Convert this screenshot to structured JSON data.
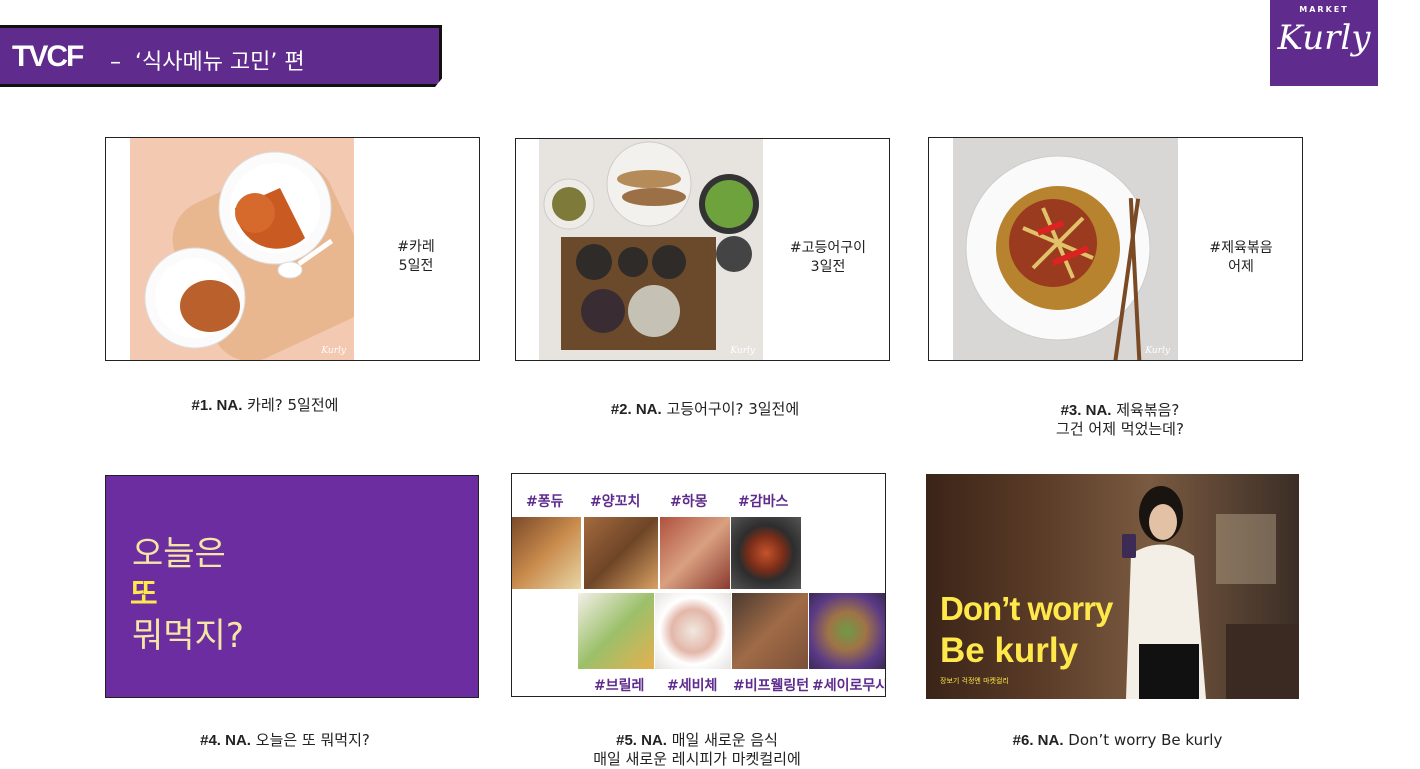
{
  "header": {
    "title": "TVCF",
    "subtitle": "–  ‘식사메뉴 고민’ 편"
  },
  "logo": {
    "top": "MARKET",
    "name": "Kurly"
  },
  "watermark": "Kurly",
  "scenes": [
    {
      "side": [
        "#카레",
        "5일전"
      ],
      "caption_bold": "#1. NA.",
      "caption": [
        "카레? 5일전에"
      ]
    },
    {
      "side": [
        "#고등어구이",
        "3일전"
      ],
      "caption_bold": "#2. NA.",
      "caption": [
        "고등어구이? 3일전에"
      ]
    },
    {
      "side": [
        "#제육볶음",
        "어제"
      ],
      "caption_bold": "#3. NA.",
      "caption": [
        "제육볶음?",
        "그건 어제 먹었는데?"
      ]
    },
    {
      "panel": [
        "오늘은",
        "또",
        "뭐먹지?"
      ],
      "caption_bold": "#4. NA.",
      "caption": [
        "오늘은 또 뭐먹지?"
      ]
    },
    {
      "tags_top": [
        "#퐁듀",
        "#양꼬치",
        "#하몽",
        "#감바스"
      ],
      "tags_bottom": [
        "#브릴레",
        "#세비체",
        "#비프웰링턴",
        "#세이로무시"
      ],
      "caption_bold": "#5. NA.",
      "caption": [
        "매일 새로운 음식",
        "매일 새로운 레시피가 마켓컬리에"
      ]
    },
    {
      "ad": [
        "Don’t worry",
        "Be kurly",
        "장보기 걱정엔 마켓컬리"
      ],
      "caption_bold": "#6. NA.",
      "caption": [
        "Don’t worry Be kurly"
      ]
    }
  ],
  "colors": {
    "brand_purple": "#5f2b8d",
    "panel_purple": "#6c2da1",
    "highlight_yellow": "#ffe84a"
  }
}
